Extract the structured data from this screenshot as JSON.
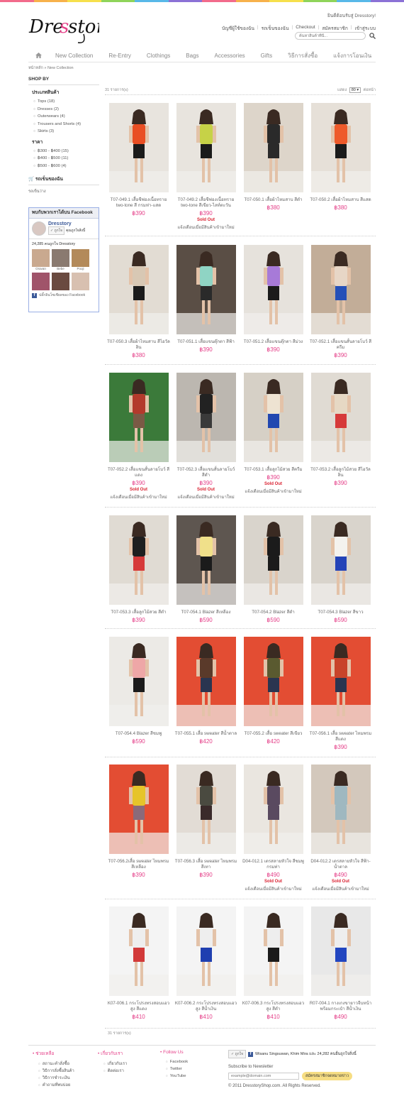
{
  "brand": {
    "name": "Dresstory",
    "colors": [
      "#f26b8b",
      "#f7b14b",
      "#f6e04c",
      "#8fd45a",
      "#58b8e8",
      "#8b71d6",
      "#f26b8b",
      "#f7b14b",
      "#f6e04c",
      "#8fd45a",
      "#58b8e8",
      "#8b71d6"
    ]
  },
  "header": {
    "welcome": "ยินดีต้อนรับสู่ Dresstory!",
    "links": [
      "บัญชีผู้ใช้ของฉัน",
      "รถเข็นของฉัน",
      "Checkout",
      "สมัครสมาชิก",
      "เข้าสู่ระบบ"
    ],
    "search_placeholder": "ค้นหาสินค้าที่นี่..."
  },
  "nav": [
    "New Collection",
    "Re-Entry",
    "Clothings",
    "Bags",
    "Accessories",
    "Gifts",
    "วิธีการสั่งซื้อ",
    "แจ้งการโอนเงิน"
  ],
  "breadcrumb": {
    "home": "หน้าหลัก",
    "current": "New Collection"
  },
  "sidebar": {
    "title": "SHOP BY",
    "category_title": "ประเภทสินค้า",
    "categories": [
      "Tops (18)",
      "Dresses (2)",
      "Outerwears (4)",
      "Trousers and Shorts (4)",
      "Skirts (3)"
    ],
    "price_title": "ราคา",
    "prices": [
      "฿300 - ฿400 (15)",
      "฿400 - ฿500 (11)",
      "฿500 - ฿600 (4)"
    ],
    "cart_title": "รถเข็นของฉัน",
    "cart_empty": "รถเข็นว่าง"
  },
  "facebook": {
    "header": "พบกับพวกเราได้บน Facebook",
    "page_name": "Dresstory",
    "like": "ถูกใจ",
    "liked_by": "คุณถูกใจสิ่งนี้",
    "count": "24,285 คนถูกใจ Dresstory",
    "faces": [
      "Oravan",
      "Bebe",
      "Pooji",
      "",
      "",
      ""
    ],
    "footer": "ปลั๊กอินโซเชียลของ Facebook"
  },
  "toolbar": {
    "count": "31 รายการ(s)",
    "show_label": "แสดง",
    "show_value": "80",
    "per_page": "ต่อหน้า"
  },
  "products": [
    {
      "name": "T07-049.1 เสื้อชีฟองเนื้อทราย two-tone สี กรมท่า-แสด",
      "price": "฿390",
      "soldout": "",
      "notify": "",
      "top": "#e94e23",
      "bottom": "#1b1b1b",
      "bg": "#e8e4de"
    },
    {
      "name": "T07-049.2 เสื้อชีฟองเนื้อทราย two-tone สีเขียว-ไลท์ตะวัน",
      "price": "฿390",
      "soldout": "Sold Out",
      "notify": "แจ้งเตือนเมื่อมีสินค้าเข้ามาใหม่",
      "top": "#c6d247",
      "bottom": "#1b1b1b",
      "bg": "#e8e4de"
    },
    {
      "name": "T07-050.1 เสื้อผ้าไหมสาบ สีดำ",
      "price": "฿380",
      "soldout": "",
      "notify": "",
      "top": "#2a2a2a",
      "bottom": "#2a2a2a",
      "bg": "#ddd5ca"
    },
    {
      "name": "T07-050.2 เสื้อผ้าไหมสาบ สีแสด",
      "price": "฿380",
      "soldout": "",
      "notify": "",
      "top": "#ee5a2a",
      "bottom": "#1b1b1b",
      "bg": "#e6e0d8"
    },
    {
      "name": "T07-050.3 เสื้อผ้าไหมสาบ สีไอวัลลิน",
      "price": "฿380",
      "soldout": "",
      "notify": "",
      "top": "#d8c8b4",
      "bottom": "#1b1b1b",
      "bg": "#e2dcd3"
    },
    {
      "name": "T07-051.1 เสื้อแขนตุ๊กตา สีฟ้า",
      "price": "฿390",
      "soldout": "",
      "notify": "",
      "top": "#8fd4c4",
      "bottom": "#2a2a2a",
      "bg": "#5a4e45"
    },
    {
      "name": "T07-051.2 เสื้อแขนตุ๊กตา สีม่วง",
      "price": "฿390",
      "soldout": "",
      "notify": "",
      "top": "#a77ad8",
      "bottom": "#1b1b1b",
      "bg": "#e6e2dc"
    },
    {
      "name": "T07-052.1 เสื้อแขนสั้นลายโบว์ สีครีม",
      "price": "฿390",
      "soldout": "",
      "notify": "",
      "top": "#e7d6c6",
      "bottom": "#2550b8",
      "bg": "#c2ad98"
    },
    {
      "name": "T07-052.2 เสื้อแขนสั้นลายโบว์ สีแดง",
      "price": "฿390",
      "soldout": "Sold Out",
      "notify": "แจ้งเตือนเมื่อมีสินค้าเข้ามาใหม่",
      "top": "#b33a2c",
      "bottom": "#7a5a45",
      "bg": "#3b7a3a"
    },
    {
      "name": "T07-052.3 เสื้อแขนสั้นลายโบว์ สีดำ",
      "price": "฿390",
      "soldout": "Sold Out",
      "notify": "แจ้งเตือนเมื่อมีสินค้าเข้ามาใหม่",
      "top": "#222222",
      "bottom": "#3a3a3a",
      "bg": "#bcb7b0"
    },
    {
      "name": "T07-053.1 เสื้อลูกไม้สวย สีครีม",
      "price": "฿390",
      "soldout": "Sold Out",
      "notify": "แจ้งเตือนเมื่อมีสินค้าเข้ามาใหม่",
      "top": "#eee3d2",
      "bottom": "#2247b0",
      "bg": "#d6d0c6"
    },
    {
      "name": "T07-053.2 เสื้อลูกไม้สวย สีไอวัลลิน",
      "price": "฿390",
      "soldout": "",
      "notify": "",
      "top": "#e6d8c4",
      "bottom": "#d63a3a",
      "bg": "#e0dbd3"
    },
    {
      "name": "T07-053.3 เสื้อลูกไม้สวย สีดำ",
      "price": "฿390",
      "soldout": "",
      "notify": "",
      "top": "#1f1f1f",
      "bottom": "#d63a3a",
      "bg": "#e0dbd3"
    },
    {
      "name": "T07-054.1 Blazer สีเหลือง",
      "price": "฿590",
      "soldout": "",
      "notify": "",
      "top": "#f0e08a",
      "bottom": "#1b1b1b",
      "bg": "#5e5650"
    },
    {
      "name": "T07-054.2 Blazer สีดำ",
      "price": "฿590",
      "soldout": "",
      "notify": "",
      "top": "#1b1b1b",
      "bottom": "#1b1b1b",
      "bg": "#d9d4cc"
    },
    {
      "name": "T07-054.3 Blazer สีขาว",
      "price": "฿590",
      "soldout": "",
      "notify": "",
      "top": "#f4f2ee",
      "bottom": "#2443b8",
      "bg": "#d9d4cc"
    },
    {
      "name": "T07-054.4 Blazer สีชมพู",
      "price": "฿590",
      "soldout": "",
      "notify": "",
      "top": "#eea7a7",
      "bottom": "#1b1b1b",
      "bg": "#eceae6"
    },
    {
      "name": "T07-055.1 เสื้อ sweater สีน้ำตาล",
      "price": "฿420",
      "soldout": "",
      "notify": "",
      "top": "#5a3a2a",
      "bottom": "#2a3550",
      "bg": "#e34d33"
    },
    {
      "name": "T07-055.2 เสื้อ sweater สีเขียว",
      "price": "฿420",
      "soldout": "",
      "notify": "",
      "top": "#5a5a30",
      "bottom": "#2a3550",
      "bg": "#e34d33"
    },
    {
      "name": "T07-056.1 เสื้อ sweater ไหมพรมสีแดง",
      "price": "฿390",
      "soldout": "",
      "notify": "",
      "top": "#c8442a",
      "bottom": "#2a3550",
      "bg": "#e34d33"
    },
    {
      "name": "T07-056.2เสื้อ sweater ไหมพรมสีเหลือง",
      "price": "฿390",
      "soldout": "",
      "notify": "",
      "top": "#e6c42a",
      "bottom": "#8a6a7a",
      "bg": "#e34d33"
    },
    {
      "name": "T07-056.3 เสื้อ sweater ไหมพรมสีเทา",
      "price": "฿390",
      "soldout": "",
      "notify": "",
      "top": "#4a4a40",
      "bottom": "#3a2a2a",
      "bg": "#e2dcd5"
    },
    {
      "name": "D04-012.1 เดรสลายหัวใจ สีชมพูกรมท่า",
      "price": "฿490",
      "soldout": "Sold Out",
      "notify": "แจ้งเตือนเมื่อมีสินค้าเข้ามาใหม่",
      "top": "#5a4a60",
      "bottom": "#5a4a60",
      "bg": "#eae6e0"
    },
    {
      "name": "D04-012.2 เดรสลายหัวใจ สีฟ้า-น้ำตาล",
      "price": "฿490",
      "soldout": "Sold Out",
      "notify": "แจ้งเตือนเมื่อมีสินค้าเข้ามาใหม่",
      "top": "#9fb8c0",
      "bottom": "#9fb8c0",
      "bg": "#d3c8bc"
    },
    {
      "name": "K07-006.1 กระโปรงทรงสอบแอวสูง สีแดง",
      "price": "฿410",
      "soldout": "",
      "notify": "",
      "top": "#eeeeee",
      "bottom": "#d23a3a",
      "bg": "#f4f4f4"
    },
    {
      "name": "K07-006.2 กระโปรงทรงสอบแอวสูง สีน้ำเงิน",
      "price": "฿410",
      "soldout": "",
      "notify": "",
      "top": "#eeeeee",
      "bottom": "#1f3fb0",
      "bg": "#f4f4f4"
    },
    {
      "name": "K07-006.3 กระโปรงทรงสอบแอวสูง สีดำ",
      "price": "฿410",
      "soldout": "",
      "notify": "",
      "top": "#eeeeee",
      "bottom": "#1b1b1b",
      "bg": "#f4f4f4"
    },
    {
      "name": "R07-004.1 กางเกงขายาวจีบหน้าพร้อมกระเป๋า สีน้ำเงิน",
      "price": "฿490",
      "soldout": "",
      "notify": "",
      "top": "#eeeeee",
      "bottom": "#2246c0",
      "bg": "#e8e8e8"
    }
  ],
  "footer": {
    "help_title": "ช่วยเหลือ",
    "help": [
      "สถานะคำสั่งซื้อ",
      "วิธีการสั่งซื้อสินค้า",
      "วิธีการชำระเงิน",
      "คำถามที่พบบ่อย"
    ],
    "about_title": "เกี่ยวกับเรา",
    "about": [
      "เกี่ยวกับเรา",
      "ติดต่อเรา"
    ],
    "follow_title": "Follow Us",
    "follow": [
      "Facebook",
      "Twitter",
      "YouTube"
    ],
    "like_btn": "ถูกใจ",
    "like_text": "Wisanu Singsuwan, Khim Mira และ 24,282 คนอื่นถูกใจสิ่งนี้",
    "subscribe_title": "Subscribe to Newsletter",
    "email_placeholder": "example@domain.com",
    "subscribe_btn": "สมัครสมาชิกจดหมายข่าว",
    "copyright": "© 2011 DresstoryShop.com. All Rights Reserved."
  }
}
